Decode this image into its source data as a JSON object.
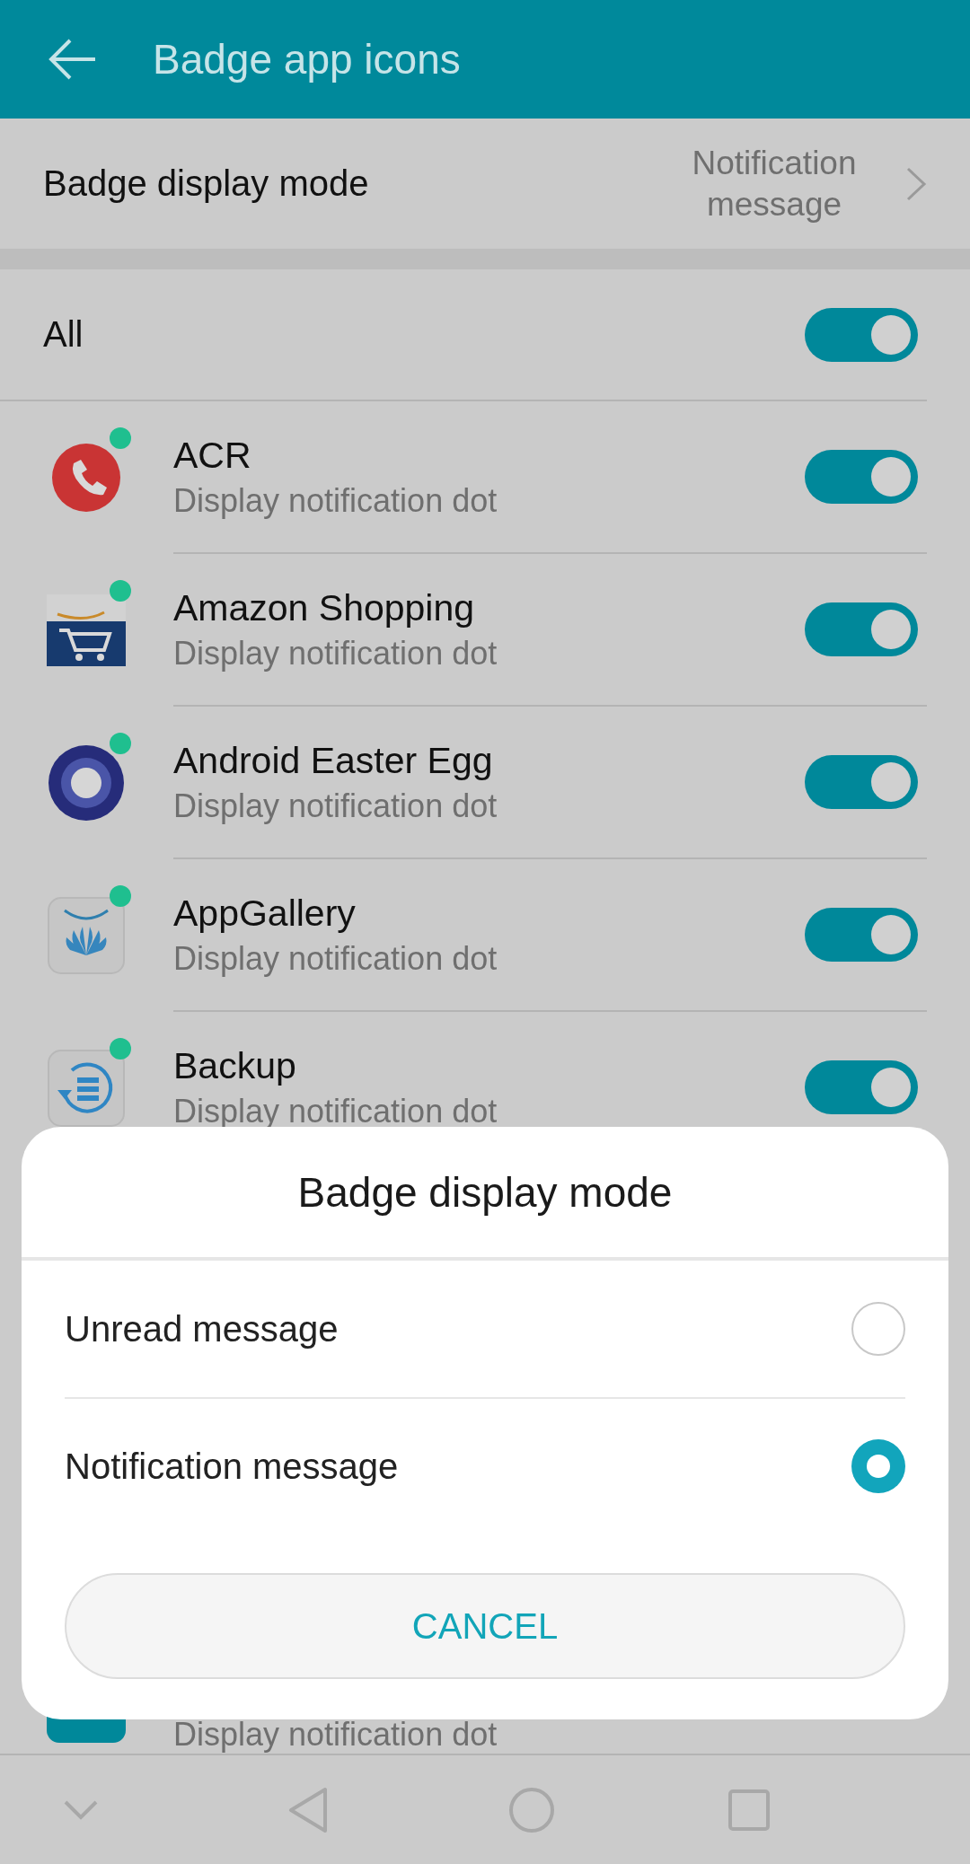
{
  "header": {
    "title": "Badge app icons"
  },
  "mode_row": {
    "label": "Badge display mode",
    "value": "Notification message"
  },
  "all": {
    "label": "All",
    "on": true
  },
  "apps": [
    {
      "kind": "phone",
      "name": "ACR",
      "subtitle": "Display notification dot",
      "on": true,
      "badge_dot": true
    },
    {
      "kind": "shop",
      "name": "Amazon Shopping",
      "subtitle": "Display notification dot",
      "on": true,
      "badge_dot": true
    },
    {
      "kind": "ring",
      "name": "Android Easter Egg",
      "subtitle": "Display notification dot",
      "on": true,
      "badge_dot": true
    },
    {
      "kind": "gallery",
      "name": "AppGallery",
      "subtitle": "Display notification dot",
      "on": true,
      "badge_dot": true
    },
    {
      "kind": "backup",
      "name": "Backup",
      "subtitle": "Display notification dot",
      "on": true,
      "badge_dot": true
    }
  ],
  "partial_row": {
    "subtitle": "Display notification dot"
  },
  "dialog": {
    "title": "Badge display mode",
    "options": [
      {
        "label": "Unread message",
        "selected": false
      },
      {
        "label": "Notification message",
        "selected": true
      }
    ],
    "cancel": "CANCEL"
  }
}
